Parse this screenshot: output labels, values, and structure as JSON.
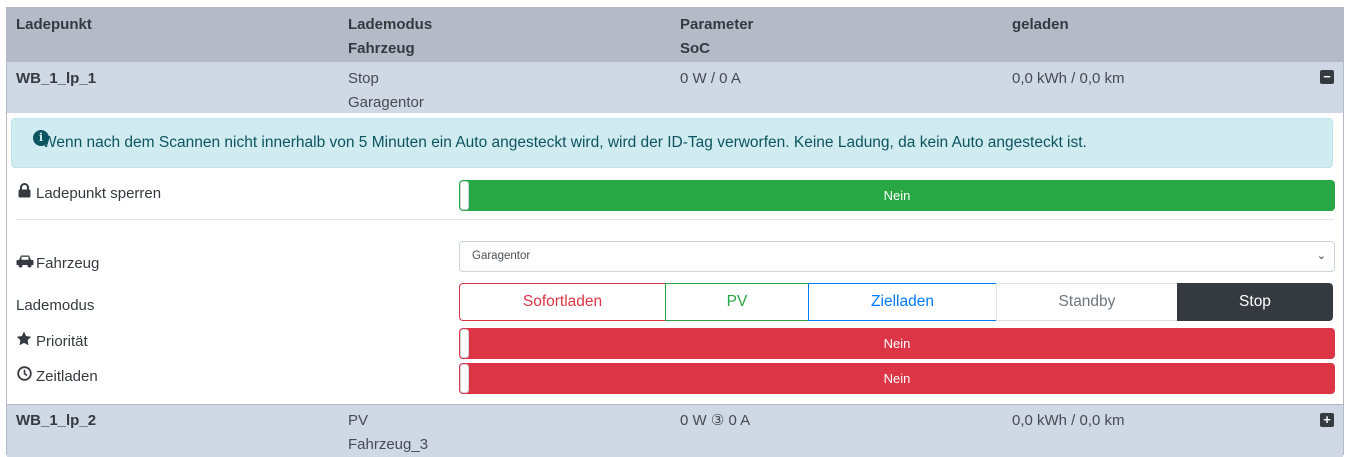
{
  "header": {
    "col1": "Ladepunkt",
    "col2_line1": "Lademodus",
    "col2_line2": "Fahrzeug",
    "col3_line1": "Parameter",
    "col3_line2": "SoC",
    "col4": "geladen"
  },
  "rows": [
    {
      "name": "WB_1_lp_1",
      "mode": "Stop",
      "vehicle": "Garagentor",
      "params": "0 W / 0 A",
      "charged": "0,0 kWh / 0,0 km",
      "toggle": "−",
      "toggle_icon": "minus-square-icon",
      "expanded": true
    },
    {
      "name": "WB_1_lp_2",
      "mode": "PV",
      "vehicle": "Fahrzeug_3",
      "params": "0 W ③ 0 A",
      "charged": "0,0 kWh / 0,0 km",
      "toggle": "+",
      "toggle_icon": "plus-square-icon",
      "expanded": false
    }
  ],
  "detail": {
    "alert_icon": "i",
    "alert": "Wenn nach dem Scannen nicht innerhalb von 5 Minuten ein Auto angesteckt wird, wird der ID-Tag verworfen. Keine Ladung, da kein Auto angesteckt ist.",
    "lock": {
      "icon": "lock-icon",
      "label": "Ladepunkt sperren",
      "value": "Nein",
      "color": "#28a745"
    },
    "vehicle": {
      "icon": "car-icon",
      "label": "Fahrzeug",
      "selected": "Garagentor"
    },
    "mode": {
      "label": "Lademodus",
      "options": [
        "Sofortladen",
        "PV",
        "Zielladen",
        "Standby",
        "Stop"
      ],
      "active": "Stop"
    },
    "priority": {
      "icon": "star-icon",
      "label": "Priorität",
      "value": "Nein",
      "color": "#dc3545"
    },
    "timed": {
      "icon": "clock-icon",
      "label": "Zeitladen",
      "value": "Nein",
      "color": "#dc3545"
    }
  },
  "colors": {
    "header_bg": "#b5bac8",
    "row_bg": "#d1d8e5",
    "alert_bg": "#d1ecf1",
    "success": "#28a745",
    "danger": "#dc3545",
    "primary": "#007bff",
    "dark": "#343a40"
  }
}
